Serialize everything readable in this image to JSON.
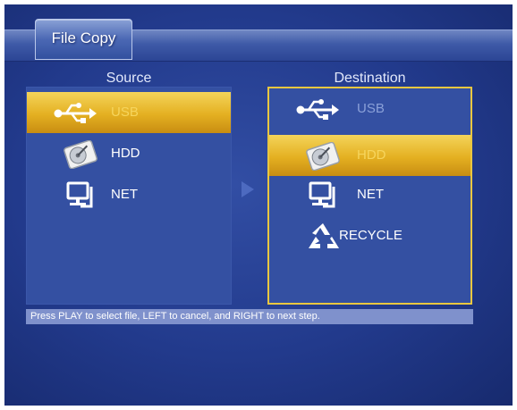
{
  "window": {
    "title": "File Copy"
  },
  "source": {
    "header": "Source",
    "items": [
      {
        "label": "USB",
        "icon": "usb-icon",
        "selected": true
      },
      {
        "label": "HDD",
        "icon": "hdd-icon",
        "selected": false
      },
      {
        "label": "NET",
        "icon": "network-computer-icon",
        "selected": false
      }
    ]
  },
  "destination": {
    "header": "Destination",
    "items": [
      {
        "label": "USB",
        "icon": "usb-icon",
        "selected": false,
        "disabled": true
      },
      {
        "label": "HDD",
        "icon": "hdd-icon",
        "selected": true
      },
      {
        "label": "NET",
        "icon": "network-computer-icon",
        "selected": false
      },
      {
        "label": "RECYCLE",
        "icon": "recycle-icon",
        "selected": false
      }
    ]
  },
  "hint": {
    "text": "Press PLAY to select file, LEFT to cancel, and RIGHT to next step."
  },
  "colors": {
    "background": "#223a8c",
    "highlight": "#e4b021",
    "border": "#e9c740",
    "hint_bar": "#7f91cc"
  }
}
